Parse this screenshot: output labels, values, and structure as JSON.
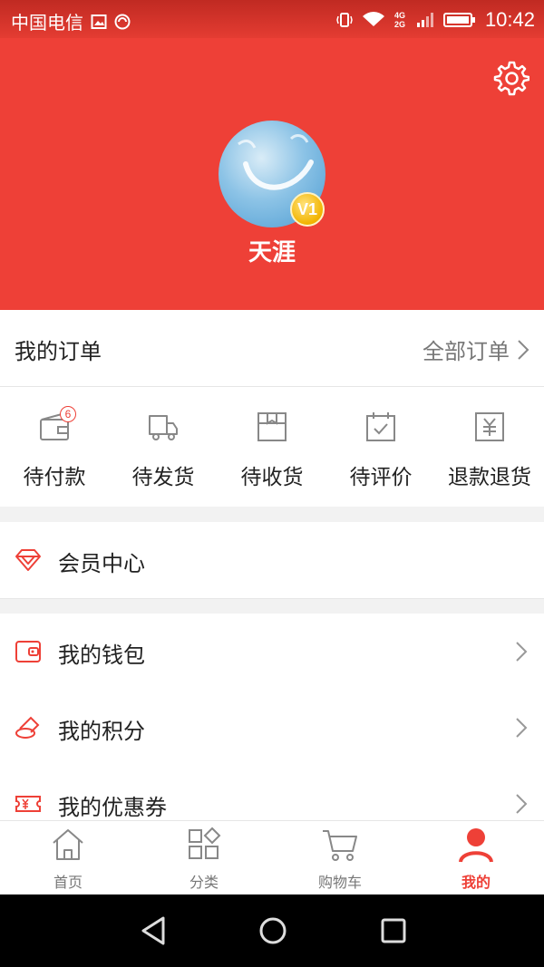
{
  "status_bar": {
    "carrier": "中国电信",
    "time": "10:42",
    "network": "4G 2G"
  },
  "profile": {
    "username": "天涯",
    "level_badge": "V1"
  },
  "orders": {
    "title": "我的订单",
    "all_orders": "全部订单",
    "statuses": [
      {
        "label": "待付款",
        "icon": "wallet-icon",
        "badge": "6"
      },
      {
        "label": "待发货",
        "icon": "truck-icon"
      },
      {
        "label": "待收货",
        "icon": "box-icon"
      },
      {
        "label": "待评价",
        "icon": "calendar-check-icon"
      },
      {
        "label": "退款退货",
        "icon": "refund-icon"
      }
    ]
  },
  "member_center": {
    "label": "会员中心",
    "icon": "diamond-icon"
  },
  "menu": [
    {
      "label": "我的钱包",
      "icon": "wallet-icon"
    },
    {
      "label": "我的积分",
      "icon": "points-icon"
    },
    {
      "label": "我的优惠券",
      "icon": "coupon-icon"
    }
  ],
  "tabbar": [
    {
      "label": "首页",
      "icon": "home-icon"
    },
    {
      "label": "分类",
      "icon": "category-icon"
    },
    {
      "label": "购物车",
      "icon": "cart-icon"
    },
    {
      "label": "我的",
      "icon": "user-icon",
      "active": true
    }
  ],
  "colors": {
    "primary": "#ee4037",
    "tab_inactive": "#777777"
  }
}
